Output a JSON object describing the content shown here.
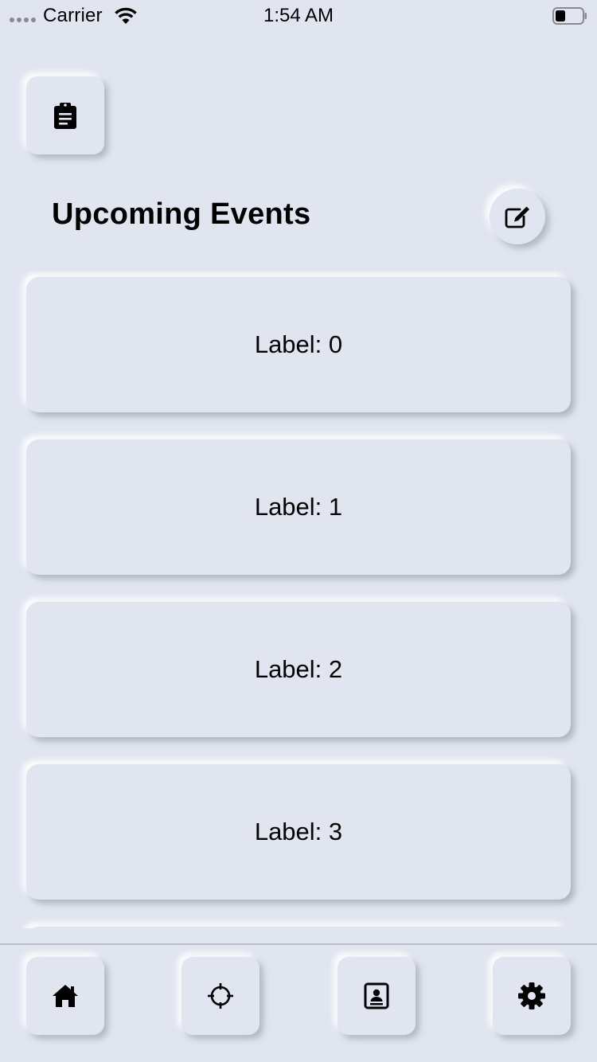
{
  "status_bar": {
    "carrier": "Carrier",
    "time": "1:54 AM",
    "icons": [
      "signal-dots-icon",
      "wifi-icon",
      "battery-icon"
    ]
  },
  "header": {
    "clipboard_icon": "clipboard-icon",
    "title": "Upcoming Events",
    "edit_icon": "edit-icon"
  },
  "events": [
    {
      "label": "Label: 0"
    },
    {
      "label": "Label: 1"
    },
    {
      "label": "Label: 2"
    },
    {
      "label": "Label: 3"
    },
    {
      "label": ""
    }
  ],
  "tab_bar": {
    "items": [
      {
        "icon": "home-icon",
        "selected": true
      },
      {
        "icon": "target-icon",
        "selected": false
      },
      {
        "icon": "contact-card-icon",
        "selected": false
      },
      {
        "icon": "gear-icon",
        "selected": false
      }
    ]
  },
  "colors": {
    "background": "#e0e5ef",
    "text": "#000000",
    "divider": "#b9bdc6"
  }
}
